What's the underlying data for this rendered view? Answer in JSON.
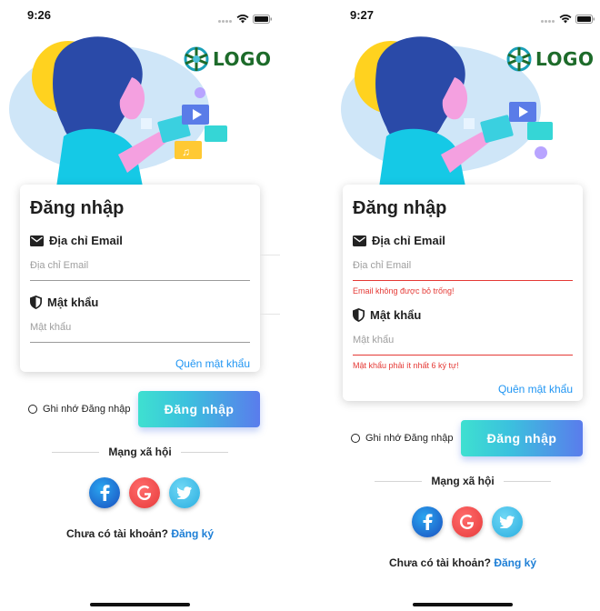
{
  "screens": [
    {
      "status": {
        "time": "9:26"
      },
      "logo_text": "LOGO",
      "title": "Đăng nhập",
      "email": {
        "label": "Địa chỉ Email",
        "placeholder": "Địa chỉ Email",
        "value": "",
        "error": ""
      },
      "password": {
        "label": "Mật khẩu",
        "placeholder": "Mật khẩu",
        "value": "",
        "error": ""
      },
      "forgot": "Quên mật khẩu",
      "remember": "Ghi nhớ Đăng nhập",
      "login_button": "Đăng nhập",
      "social_title": "Mạng xã hội",
      "signup_text": "Chưa có tài khoản?",
      "signup_link": "Đăng ký"
    },
    {
      "status": {
        "time": "9:27"
      },
      "logo_text": "LOGO",
      "title": "Đăng nhập",
      "email": {
        "label": "Địa chỉ Email",
        "placeholder": "Địa chỉ Email",
        "value": "",
        "error": "Email không được bỏ trống!"
      },
      "password": {
        "label": "Mật khẩu",
        "placeholder": "Mật khẩu",
        "value": "",
        "error": "Mật khẩu phải ít nhất 6 ký tự!"
      },
      "forgot": "Quên mật khẩu",
      "remember": "Ghi nhớ Đăng nhập",
      "login_button": "Đăng nhập",
      "social_title": "Mạng xã hội",
      "signup_text": "Chưa có tài khoản?",
      "signup_link": "Đăng ký"
    }
  ],
  "colors": {
    "accent_blue": "#2196f3",
    "error_red": "#e53935",
    "logo_green": "#1d6b2a",
    "button_gradient_start": "#3ee0d0",
    "button_gradient_end": "#5a7cec"
  },
  "icons": [
    "wifi-icon",
    "battery-icon",
    "mail-icon",
    "shield-icon",
    "facebook-icon",
    "google-icon",
    "twitter-icon",
    "logo-icon"
  ]
}
